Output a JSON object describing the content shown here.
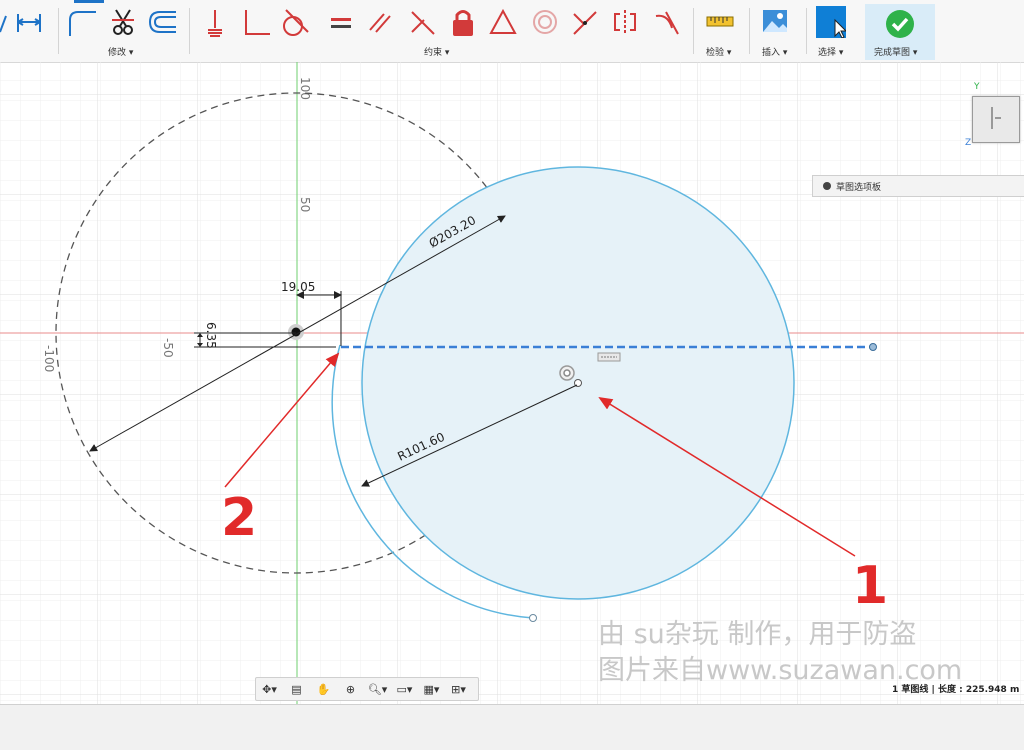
{
  "toolbar": {
    "groups": {
      "modify": "修改 ▾",
      "constraints": "约束 ▾",
      "inspect": "检验 ▾",
      "insert": "插入 ▾",
      "select": "选择 ▾",
      "finish": "完成草图 ▾"
    },
    "colors": {
      "accent": "#1e73c7",
      "constraint_red": "#d23a3a",
      "finish_green": "#2fb24a",
      "select_blue": "#0f7fd6"
    }
  },
  "canvas": {
    "axis_labels": {
      "y_100": "100",
      "y_50": "50",
      "x_neg100": "-100",
      "x_neg50": "-50"
    },
    "dimensions": {
      "diameter": "Ø203.20",
      "horizontal": "19.05",
      "vertical": "6.35",
      "radius": "R101.60"
    },
    "annotations": {
      "one": "1",
      "two": "2"
    },
    "colors": {
      "sketch_blue": "#5fb6df",
      "fill_blue": "#e6f2f8",
      "dashed_black": "#555555",
      "annotation_red": "#e12a2a",
      "x_axis": "#e88b8b",
      "y_axis": "#6fcf6f"
    }
  },
  "palette": {
    "label": "草图选项板"
  },
  "viewcube": {
    "axis_y": "Y",
    "axis_z": "Z"
  },
  "watermark": {
    "line1": "由 su杂玩 制作，用于防盗",
    "line2": "图片来自www.suzawan.com"
  },
  "status": {
    "text": "1 草图线 | 长度 : 225.948 m"
  }
}
